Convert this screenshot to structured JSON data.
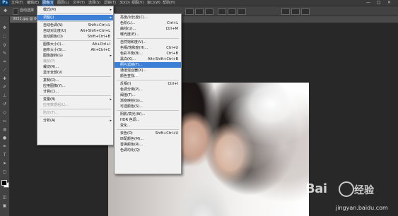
{
  "app": {
    "logo": "Ps"
  },
  "menubar": {
    "items": [
      "文件(F)",
      "编辑(E)",
      "图像(I)",
      "图层(L)",
      "文字(Y)",
      "选择(S)",
      "滤镜(T)",
      "3D(D)",
      "视图(V)",
      "窗口(W)",
      "帮助(H)"
    ],
    "active_index": 2,
    "window_controls": [
      "—",
      "□",
      "✕"
    ]
  },
  "options": {
    "auto_select": "自动选择"
  },
  "document_tab": {
    "title": "0051.jpg @ 66.7%",
    "close": "×"
  },
  "image_menu": {
    "items": [
      {
        "label": "模式(M)",
        "shortcut": "",
        "submenu": true,
        "disabled": false
      },
      {
        "sep": true
      },
      {
        "label": "调整(J)",
        "shortcut": "",
        "submenu": true,
        "highlight": true
      },
      {
        "sep": true
      },
      {
        "label": "自动色调(N)",
        "shortcut": "Shift+Ctrl+L"
      },
      {
        "label": "自动对比度(U)",
        "shortcut": "Alt+Shift+Ctrl+L"
      },
      {
        "label": "自动颜色(O)",
        "shortcut": "Shift+Ctrl+B"
      },
      {
        "sep": true
      },
      {
        "label": "图像大小(I)...",
        "shortcut": "Alt+Ctrl+I"
      },
      {
        "label": "画布大小(S)...",
        "shortcut": "Alt+Ctrl+C"
      },
      {
        "label": "图像旋转(G)",
        "shortcut": "",
        "submenu": true
      },
      {
        "label": "裁剪(P)",
        "shortcut": "",
        "disabled": true
      },
      {
        "label": "裁切(R)...",
        "shortcut": ""
      },
      {
        "label": "显示全部(V)",
        "shortcut": ""
      },
      {
        "sep": true
      },
      {
        "label": "复制(D)...",
        "shortcut": ""
      },
      {
        "label": "应用图像(Y)...",
        "shortcut": ""
      },
      {
        "label": "计算(C)...",
        "shortcut": ""
      },
      {
        "sep": true
      },
      {
        "label": "变量(B)",
        "shortcut": "",
        "submenu": true
      },
      {
        "label": "应用数据组(L)...",
        "shortcut": "",
        "disabled": true
      },
      {
        "sep": true
      },
      {
        "label": "陷印(T)...",
        "shortcut": "",
        "disabled": true
      },
      {
        "sep": true
      },
      {
        "label": "分析(A)",
        "shortcut": "",
        "submenu": true
      }
    ]
  },
  "adjust_menu": {
    "items": [
      {
        "label": "亮度/对比度(C)...",
        "shortcut": ""
      },
      {
        "label": "色阶(L)...",
        "shortcut": "Ctrl+L"
      },
      {
        "label": "曲线(U)...",
        "shortcut": "Ctrl+M"
      },
      {
        "label": "曝光度(E)...",
        "shortcut": ""
      },
      {
        "sep": true
      },
      {
        "label": "自然饱和度(V)...",
        "shortcut": ""
      },
      {
        "label": "色相/饱和度(H)...",
        "shortcut": "Ctrl+U"
      },
      {
        "label": "色彩平衡(B)...",
        "shortcut": "Ctrl+B"
      },
      {
        "label": "黑白(K)...",
        "shortcut": "Alt+Shift+Ctrl+B"
      },
      {
        "label": "照片滤镜(F)...",
        "shortcut": "",
        "highlight": true
      },
      {
        "label": "通道混合器(X)...",
        "shortcut": ""
      },
      {
        "label": "颜色查找...",
        "shortcut": ""
      },
      {
        "sep": true
      },
      {
        "label": "反相(I)",
        "shortcut": "Ctrl+I"
      },
      {
        "label": "色调分离(P)...",
        "shortcut": ""
      },
      {
        "label": "阈值(T)...",
        "shortcut": ""
      },
      {
        "label": "渐变映射(G)...",
        "shortcut": ""
      },
      {
        "label": "可选颜色(S)...",
        "shortcut": ""
      },
      {
        "sep": true
      },
      {
        "label": "阴影/高光(W)...",
        "shortcut": ""
      },
      {
        "label": "HDR 色调...",
        "shortcut": ""
      },
      {
        "label": "变化...",
        "shortcut": ""
      },
      {
        "sep": true
      },
      {
        "label": "去色(D)",
        "shortcut": "Shift+Ctrl+U"
      },
      {
        "label": "匹配颜色(M)...",
        "shortcut": ""
      },
      {
        "label": "替换颜色(R)...",
        "shortcut": ""
      },
      {
        "label": "色调均化(Q)",
        "shortcut": ""
      }
    ]
  },
  "watermark": {
    "logo": "Bai",
    "logo2": "经验",
    "url": "jingyan.baidu.com"
  },
  "colors": {
    "menu_highlight": "#3b7fd6",
    "menubar_active": "#2d5f9a",
    "workspace": "#282828"
  }
}
